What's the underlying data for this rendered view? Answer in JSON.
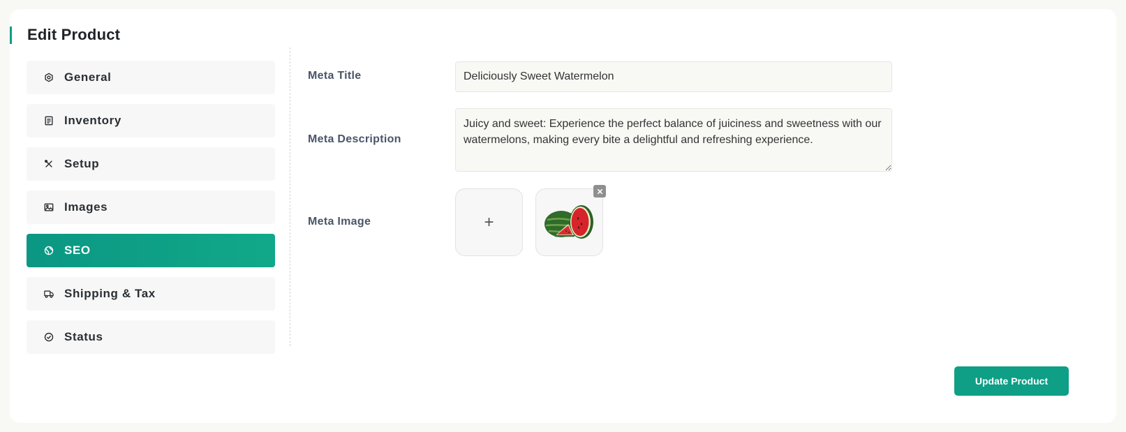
{
  "page": {
    "title": "Edit Product"
  },
  "tabs": [
    {
      "label": "General",
      "icon": "hexagon-settings-icon",
      "active": false
    },
    {
      "label": "Inventory",
      "icon": "document-list-icon",
      "active": false
    },
    {
      "label": "Setup",
      "icon": "tools-icon",
      "active": false
    },
    {
      "label": "Images",
      "icon": "image-icon",
      "active": false
    },
    {
      "label": "SEO",
      "icon": "globe-icon",
      "active": true
    },
    {
      "label": "Shipping & Tax",
      "icon": "truck-icon",
      "active": false
    },
    {
      "label": "Status",
      "icon": "check-circle-icon",
      "active": false
    }
  ],
  "seo": {
    "meta_title_label": "Meta Title",
    "meta_title_value": "Deliciously Sweet Watermelon",
    "meta_description_label": "Meta Description",
    "meta_description_value": "Juicy and sweet: Experience the perfect balance of juiciness and sweetness with our watermelons, making every bite a delightful and refreshing experience.",
    "meta_image_label": "Meta Image",
    "add_image_symbol": "+"
  },
  "actions": {
    "update_label": "Update Product"
  },
  "colors": {
    "accent": "#0e9f86",
    "tab_bg": "#f7f7f7",
    "input_bg": "#f8f8f5"
  }
}
